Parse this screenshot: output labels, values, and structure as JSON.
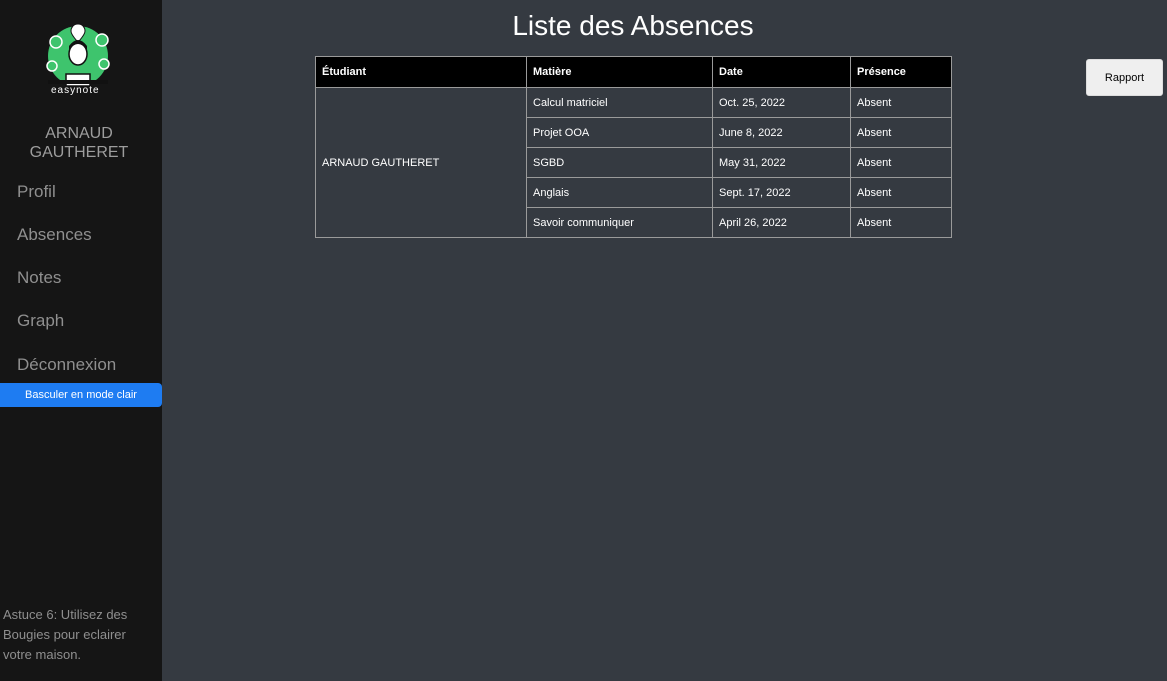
{
  "sidebar": {
    "logo_text": "easynote",
    "user_name": "ARNAUD GAUTHERET",
    "nav": [
      {
        "label": "Profil"
      },
      {
        "label": "Absences"
      },
      {
        "label": "Notes"
      },
      {
        "label": "Graph"
      },
      {
        "label": "Déconnexion"
      }
    ],
    "toggle_label": "Basculer en mode clair",
    "tip": "Astuce 6: Utilisez des Bougies pour eclairer votre maison."
  },
  "main": {
    "title": "Liste des Absences",
    "report_button": "Rapport",
    "table": {
      "headers": [
        "Étudiant",
        "Matière",
        "Date",
        "Présence"
      ],
      "student": "ARNAUD GAUTHERET",
      "rows": [
        {
          "subject": "Calcul matriciel",
          "date": "Oct. 25, 2022",
          "presence": "Absent"
        },
        {
          "subject": "Projet OOA",
          "date": "June 8, 2022",
          "presence": "Absent"
        },
        {
          "subject": "SGBD",
          "date": "May 31, 2022",
          "presence": "Absent"
        },
        {
          "subject": "Anglais",
          "date": "Sept. 17, 2022",
          "presence": "Absent"
        },
        {
          "subject": "Savoir communiquer",
          "date": "April 26, 2022",
          "presence": "Absent"
        }
      ]
    }
  },
  "colors": {
    "sidebar_bg": "#151515",
    "main_bg": "#353a41",
    "accent": "#1e7cf2",
    "logo_green": "#3ec46d"
  }
}
